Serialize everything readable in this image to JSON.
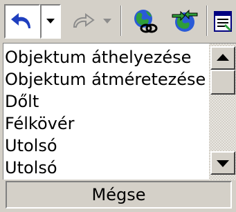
{
  "toolbar": {
    "undo": {
      "icon": "undo-icon",
      "color": "#1f3fbf"
    },
    "undo_dropdown": {
      "icon": "dropdown-arrow-icon"
    },
    "redo": {
      "icon": "redo-icon",
      "color": "#8c8c8c",
      "enabled": false
    },
    "redo_dropdown": {
      "icon": "dropdown-arrow-icon",
      "enabled": false
    },
    "hyperlink": {
      "icon": "globe-link-icon"
    },
    "web_toolbar": {
      "icon": "globe-arrows-icon"
    },
    "last": {
      "icon": "drawing-toolbar-icon"
    }
  },
  "undo_list": {
    "items": [
      "Objektum áthelyezése",
      "Objektum átméretezése",
      "Dőlt",
      "Félkövér",
      "Utolsó",
      "Utolsó"
    ]
  },
  "cancel_label": "Mégse"
}
